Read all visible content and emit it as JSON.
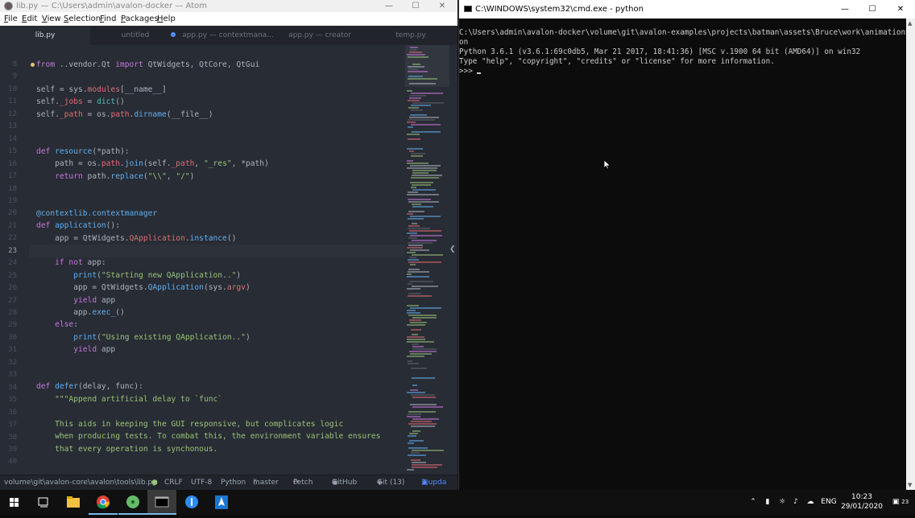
{
  "atom": {
    "title": "lib.py — C:\\Users\\admin\\avalon-docker — Atom",
    "menu": [
      "File",
      "Edit",
      "View",
      "Selection",
      "Find",
      "Packages",
      "Help"
    ],
    "tabs": [
      {
        "label": "lib.py",
        "active": true
      },
      {
        "label": "untitled",
        "modified": false
      },
      {
        "label": "app.py — contextmana...",
        "modified": true
      },
      {
        "label": "app.py — creator"
      },
      {
        "label": "temp.py"
      }
    ],
    "line_numbers": [
      "8",
      "9",
      "10",
      "11",
      "12",
      "13",
      "14",
      "15",
      "16",
      "17",
      "18",
      "19",
      "20",
      "21",
      "22",
      "23",
      "24",
      "25",
      "26",
      "27",
      "28",
      "29",
      "30",
      "31",
      "32",
      "33",
      "34",
      "35",
      "36",
      "37",
      "38",
      "39",
      "40"
    ],
    "current_line": "23",
    "code": {
      "l8": "from ..vendor.Qt import QtWidgets, QtCore, QtGui",
      "l10": "self = sys.modules[__name__]",
      "l11": "self._jobs = dict()",
      "l12": "self._path = os.path.dirname(__file__)",
      "l15": "def resource(*path):",
      "l16": "    path = os.path.join(self._path, \"_res\", *path)",
      "l17": "    return path.replace(\"\\\\\", \"/\")",
      "l20": "@contextlib.contextmanager",
      "l21": "def application():",
      "l22": "    app = QtWidgets.QApplication.instance()",
      "l24": "    if not app:",
      "l25": "        print(\"Starting new QApplication..\")",
      "l26": "        app = QtWidgets.QApplication(sys.argv)",
      "l27": "        yield app",
      "l28": "        app.exec_()",
      "l29": "    else:",
      "l30": "        print(\"Using existing QApplication..\")",
      "l31": "        yield app",
      "l34": "def defer(delay, func):",
      "l35": "    \"\"\"Append artificial delay to `func`",
      "l37": "    This aids in keeping the GUI responsive, but complicates logic",
      "l38": "    when producing tests. To combat this, the environment variable ensures",
      "l39": "    that every operation is synchonous."
    },
    "status": {
      "path": "volume\\git\\avalon-core\\avalon\\tools\\lib.py",
      "line_ending": "CRLF",
      "encoding": "UTF-8",
      "grammar": "Python",
      "branch": "master",
      "fetch": "Fetch",
      "github": "GitHub",
      "git": "Git (13)",
      "updates": "3 upda"
    }
  },
  "cmd": {
    "title": "C:\\WINDOWS\\system32\\cmd.exe - python",
    "lines": [
      "C:\\Users\\admin\\avalon-docker\\volume\\git\\avalon-examples\\projects\\batman\\assets\\Bruce\\work\\animation>pyth",
      "on",
      "Python 3.6.1 (v3.6.1:69c0db5, Mar 21 2017, 18:41:36) [MSC v.1900 64 bit (AMD64)] on win32",
      "Type \"help\", \"copyright\", \"credits\" or \"license\" for more information.",
      ">>> "
    ]
  },
  "taskbar": {
    "language": "ENG",
    "time": "10:23",
    "date": "29/01/2020",
    "notification_count": "23"
  },
  "colors": {
    "atom_bg": "#282c34",
    "keyword": "#c678dd",
    "function": "#61afef",
    "string": "#98c379",
    "attribute": "#e06c75",
    "accent": "#528bff"
  }
}
